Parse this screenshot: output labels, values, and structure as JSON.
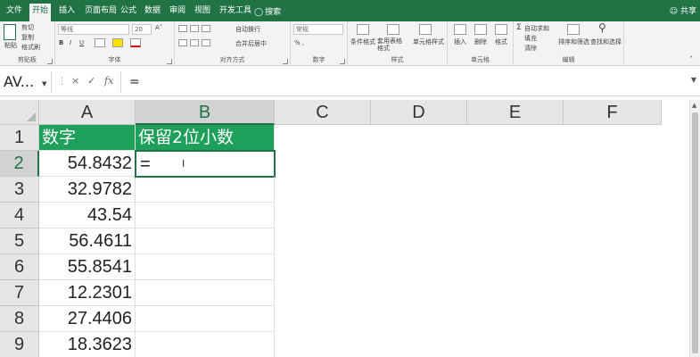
{
  "colors": {
    "brand": "#217346",
    "header_fill": "#1ea05a"
  },
  "tabs": [
    "文件",
    "开始",
    "插入",
    "页面布局",
    "公式",
    "数据",
    "审阅",
    "视图",
    "开发工具"
  ],
  "search_label": "搜索",
  "share_label": "共享",
  "ribbon": {
    "clipboard": {
      "paste": "粘贴",
      "cut": "剪切",
      "copy": "复制",
      "format_painter": "格式刷",
      "label": "剪贴板"
    },
    "font": {
      "name": "等线",
      "size": "20",
      "bold": "B",
      "italic": "I",
      "underline": "U",
      "label": "字体"
    },
    "alignment": {
      "wrap": "自动换行",
      "merge": "合并后居中",
      "label": "对齐方式"
    },
    "number": {
      "format": "常规",
      "label": "数字"
    },
    "styles": {
      "conditional": "条件格式",
      "table": "套用表格格式",
      "cell": "单元格样式",
      "label": "样式"
    },
    "cells": {
      "insert": "插入",
      "delete": "删除",
      "format": "格式",
      "label": "单元格"
    },
    "editing": {
      "autosum": "自动求和",
      "fill": "填充",
      "clear": "清除",
      "sort": "排序和筛选",
      "find": "查找和选择",
      "label": "编辑"
    }
  },
  "formula_bar": {
    "name_box": "AV...",
    "value": "="
  },
  "columns": [
    "A",
    "B",
    "C",
    "D",
    "E",
    "F"
  ],
  "rows": [
    "1",
    "2",
    "3",
    "4",
    "5",
    "6",
    "7",
    "8",
    "9"
  ],
  "sheet": {
    "header_a": "数字",
    "header_b": "保留2位小数",
    "values": [
      "54.8432",
      "32.9782",
      "43.54",
      "56.4611",
      "55.8541",
      "12.2301",
      "27.4406",
      "18.3623"
    ],
    "b2": "="
  }
}
